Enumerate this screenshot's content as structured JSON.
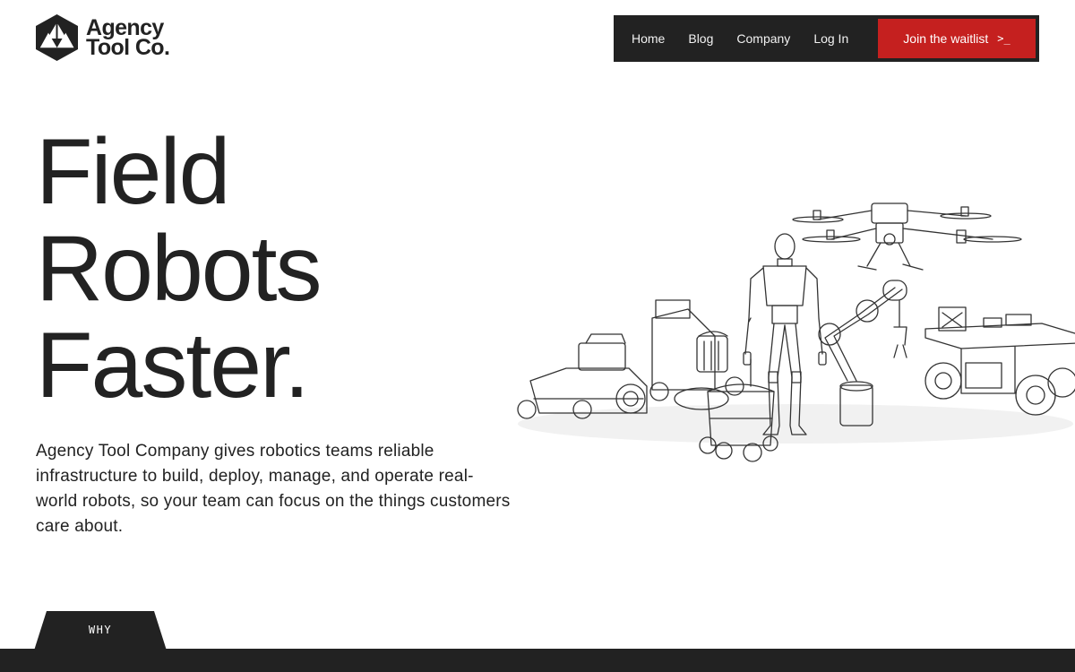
{
  "brand": {
    "logo_icon": "triangle-hexagon-icon",
    "name_line1": "Agency",
    "name_line2": "Tool Co."
  },
  "nav": {
    "items": [
      {
        "label": "Home"
      },
      {
        "label": "Blog"
      },
      {
        "label": "Company"
      },
      {
        "label": "Log In"
      }
    ],
    "cta_label": "Join the waitlist",
    "cta_prompt": ">_"
  },
  "hero": {
    "title_lines": [
      "Field",
      "Robots",
      "Faster."
    ],
    "description": "Agency Tool Company gives robotics teams reliable infrastructure to build, deploy, manage, and operate real-world robots, so your team can focus on the things customers care about."
  },
  "section_tab": {
    "label": "WHY"
  },
  "colors": {
    "dark": "#222222",
    "accent": "#c5201f",
    "background": "#ffffff"
  }
}
